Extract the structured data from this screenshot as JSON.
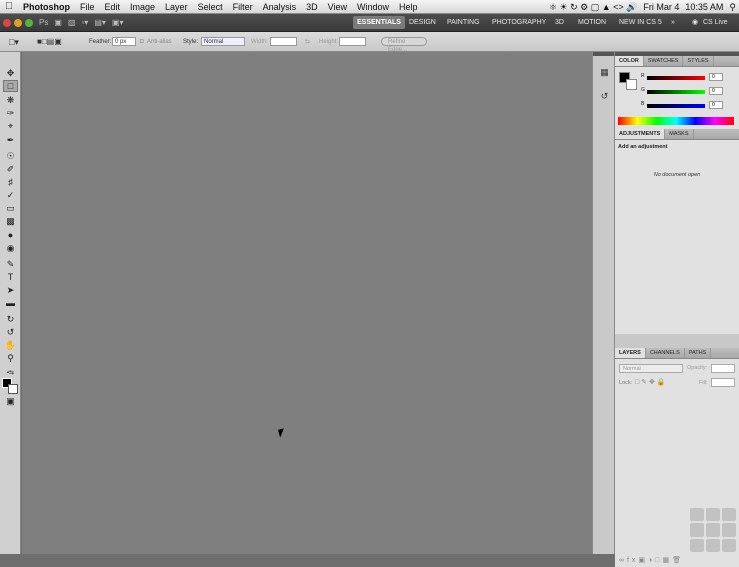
{
  "menubar": {
    "app_name": "Photoshop",
    "items": [
      "File",
      "Edit",
      "Image",
      "Layer",
      "Select",
      "Filter",
      "Analysis",
      "3D",
      "View",
      "Window",
      "Help"
    ],
    "clock_date": "Fri Mar 4",
    "clock_time": "10:35 AM"
  },
  "appbar": {
    "workspaces": [
      "ESSENTIALS",
      "DESIGN",
      "PAINTING",
      "PHOTOGRAPHY",
      "3D",
      "MOTION",
      "NEW IN CS 5"
    ],
    "cs_live": "CS Live"
  },
  "options": {
    "feather_label": "Feather:",
    "feather_value": "0 px",
    "antialias_label": "Anti-alias",
    "style_label": "Style:",
    "style_value": "Normal",
    "width_label": "Width:",
    "height_label": "Height:",
    "refine_label": "Refine Edge..."
  },
  "color_panel": {
    "tabs": [
      "COLOR",
      "SWATCHES",
      "STYLES"
    ],
    "r_label": "R",
    "g_label": "G",
    "b_label": "B",
    "r_value": "0",
    "g_value": "0",
    "b_value": "0"
  },
  "adjustments_panel": {
    "tabs": [
      "ADJUSTMENTS",
      "MASKS"
    ],
    "heading": "Add an adjustment",
    "empty_text": "No document open"
  },
  "layers_panel": {
    "tabs": [
      "LAYERS",
      "CHANNELS",
      "PATHS"
    ],
    "blend_mode": "Normal",
    "opacity_label": "Opacity:",
    "lock_label": "Lock:",
    "fill_label": "Fill:"
  },
  "colors": {
    "canvas": "#7f7f7f",
    "appbar": "#3a3a3a"
  }
}
